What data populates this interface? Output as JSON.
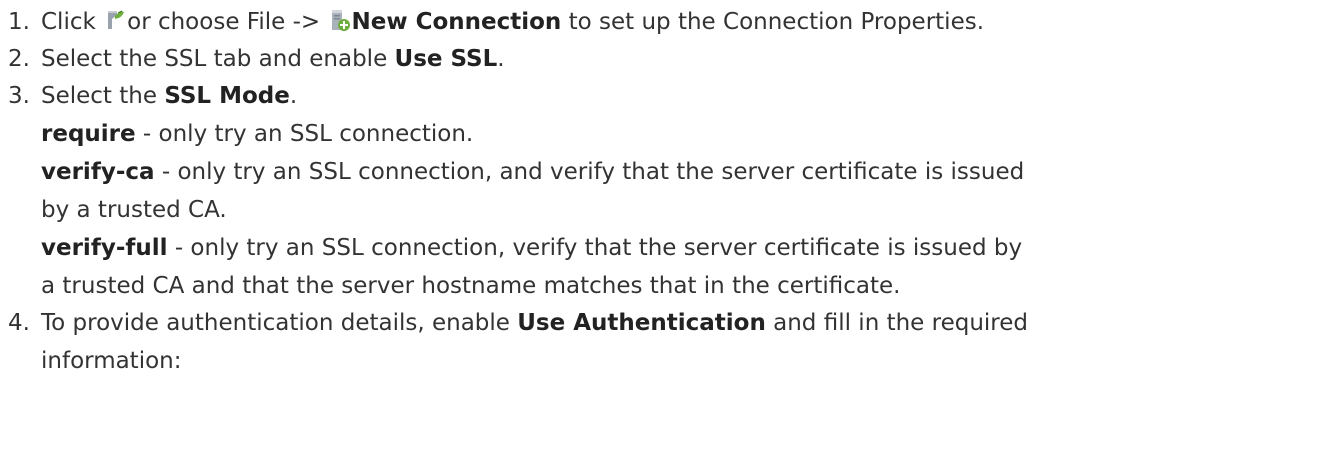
{
  "steps": [
    {
      "number": "1.",
      "text_a": "Click ",
      "text_b": "or choose File -> ",
      "bold": "New Connection",
      "text_c": " to set up the Connection Properties.",
      "icons": [
        "new-connection-toolbar-icon",
        "new-connection-menu-icon"
      ]
    },
    {
      "number": "2.",
      "text_a": "Select the SSL tab and enable ",
      "bold": "Use SSL",
      "text_c": "."
    },
    {
      "number": "3.",
      "text_a": "Select the ",
      "bold": "SSL Mode",
      "text_c": ".",
      "modes": [
        {
          "name": "require",
          "lines": [
            " - only try an SSL connection."
          ]
        },
        {
          "name": "verify-ca",
          "lines": [
            " - only try an SSL connection, and verify that the server certificate is issued",
            "by a trusted CA."
          ]
        },
        {
          "name": "verify-full",
          "lines": [
            " - only try an SSL connection, verify that the server certificate is issued by",
            "a trusted CA and that the server hostname matches that in the certificate."
          ]
        }
      ]
    },
    {
      "number": "4.",
      "text_a": "To provide authentication details, enable ",
      "bold": "Use Authentication",
      "text_c": " and fill in the required",
      "continuation": "information:"
    }
  ],
  "colors": {
    "text": "#333333",
    "bold_text": "#222222",
    "icon_green": "#6dae3c",
    "icon_gray": "#9aa3ad"
  }
}
